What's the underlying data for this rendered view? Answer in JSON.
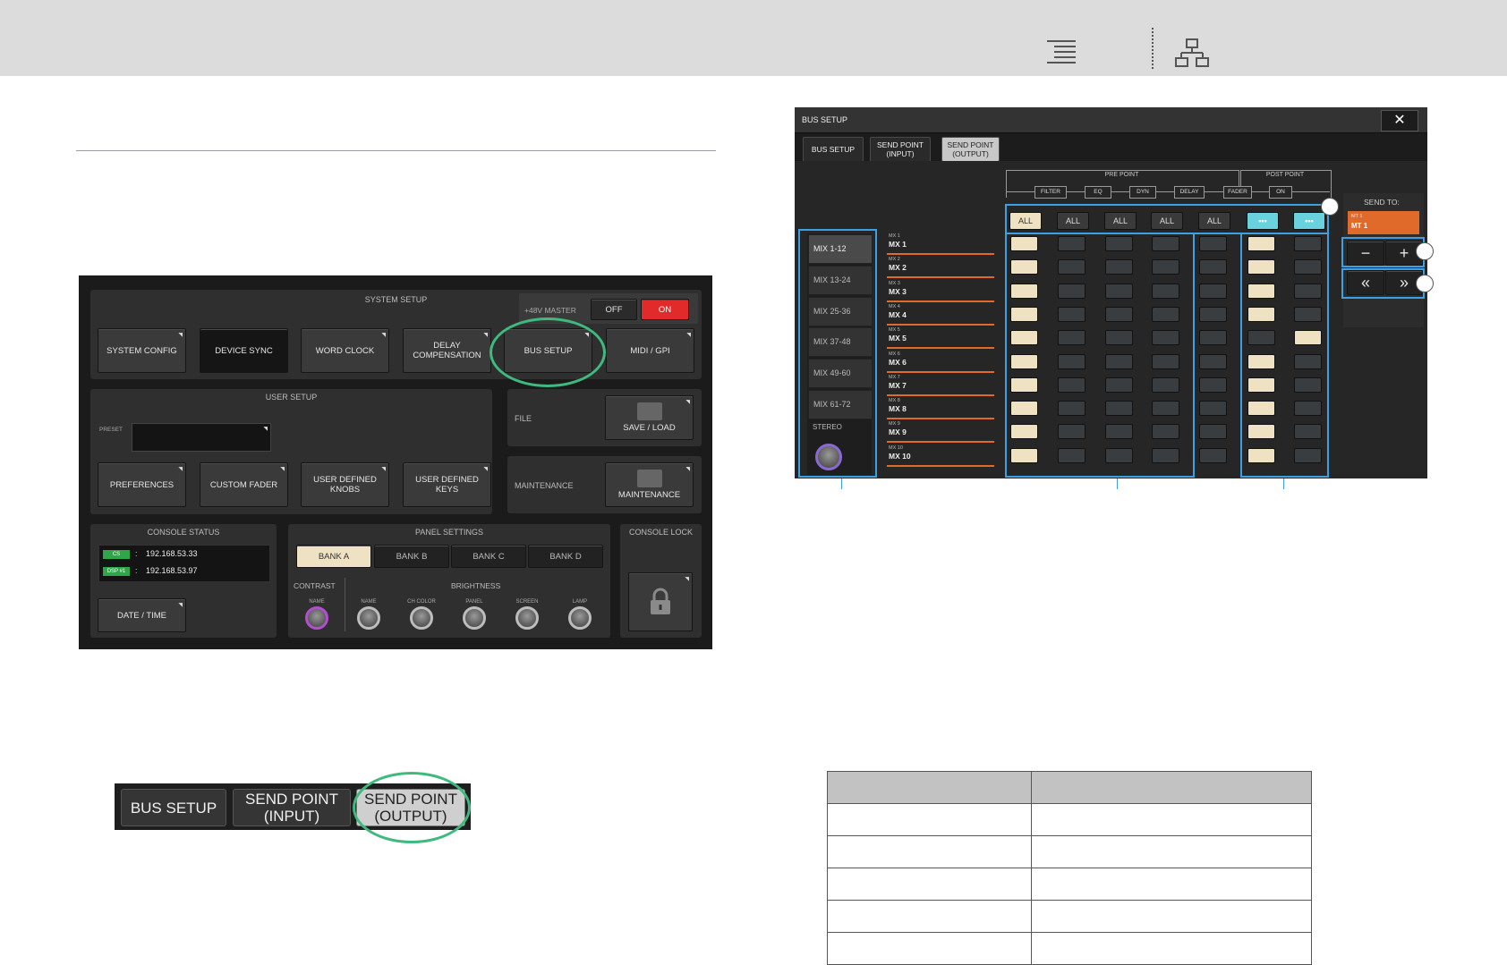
{
  "topbar": {
    "icons": [
      "indent-list-icon",
      "sitemap-icon"
    ]
  },
  "system_setup": {
    "title": "SYSTEM SETUP",
    "phantom": {
      "label": "+48V MASTER",
      "off": "OFF",
      "on": "ON"
    },
    "buttons": [
      "SYSTEM CONFIG",
      "DEVICE SYNC",
      "WORD CLOCK",
      "DELAY\nCOMPENSATION",
      "BUS SETUP",
      "MIDI / GPI"
    ],
    "user_setup": {
      "title": "USER SETUP",
      "preset_label": "PRESET",
      "buttons": [
        "PREFERENCES",
        "CUSTOM FADER",
        "USER DEFINED\nKNOBS",
        "USER DEFINED\nKEYS"
      ]
    },
    "file": {
      "label": "FILE",
      "button": "SAVE / LOAD"
    },
    "maintenance": {
      "label": "MAINTENANCE",
      "button": "MAINTENANCE"
    },
    "console_status": {
      "title": "CONSOLE STATUS",
      "rows": [
        {
          "badge": "CS",
          "sep": ":",
          "ip": "192.168.53.33"
        },
        {
          "badge": "DSP #1",
          "sep": ":",
          "ip": "192.168.53.97"
        }
      ],
      "date_time": "DATE / TIME"
    },
    "panel_settings": {
      "title": "PANEL SETTINGS",
      "banks": [
        "BANK A",
        "BANK B",
        "BANK C",
        "BANK D"
      ],
      "contrast": "CONTRAST",
      "brightness": "BRIGHTNESS",
      "knobs": [
        "NAME",
        "NAME",
        "CH COLOR",
        "PANEL",
        "SCREEN",
        "LAMP"
      ]
    },
    "console_lock": {
      "title": "CONSOLE LOCK"
    }
  },
  "tabs_crop": {
    "tabs": [
      "BUS SETUP",
      "SEND POINT\n(INPUT)",
      "SEND POINT\n(OUTPUT)"
    ]
  },
  "bus_setup": {
    "title": "BUS SETUP",
    "close": "✕",
    "tabs": [
      "BUS SETUP",
      "SEND POINT\n(INPUT)",
      "SEND POINT\n(OUTPUT)"
    ],
    "pre_point": "PRE POINT",
    "post_point": "POST POINT",
    "points": [
      "FILTER",
      "EQ",
      "DYN",
      "DELAY",
      "FADER",
      "ON"
    ],
    "all_buttons": [
      "ALL",
      "ALL",
      "ALL",
      "ALL",
      "ALL",
      "•••",
      "•••"
    ],
    "banks": [
      "MIX 1-12",
      "MIX 13-24",
      "MIX 25-36",
      "MIX 37-48",
      "MIX 49-60",
      "MIX 61-72"
    ],
    "stereo": "STEREO",
    "channels": [
      {
        "s": "MX 1",
        "m": "MX 1"
      },
      {
        "s": "MX 2",
        "m": "MX 2"
      },
      {
        "s": "MX 3",
        "m": "MX 3"
      },
      {
        "s": "MX 4",
        "m": "MX 4"
      },
      {
        "s": "MX 5",
        "m": "MX 5"
      },
      {
        "s": "MX 6",
        "m": "MX 6"
      },
      {
        "s": "MX 7",
        "m": "MX 7"
      },
      {
        "s": "MX 8",
        "m": "MX 8"
      },
      {
        "s": "MX 9",
        "m": "MX 9"
      },
      {
        "s": "MX 10",
        "m": "MX 10"
      }
    ],
    "send_to": {
      "label": "SEND TO:",
      "small": "MT 1",
      "main": "MT 1"
    },
    "minus": "−",
    "plus": "+",
    "prev": "«",
    "next": "»"
  },
  "table": {
    "rows": 6,
    "cols": 2
  },
  "colors": {
    "green_ring": "#3fba7f",
    "blue_box": "#3ea0e2",
    "on_red": "#e32a2a",
    "orange": "#e06a2a"
  }
}
